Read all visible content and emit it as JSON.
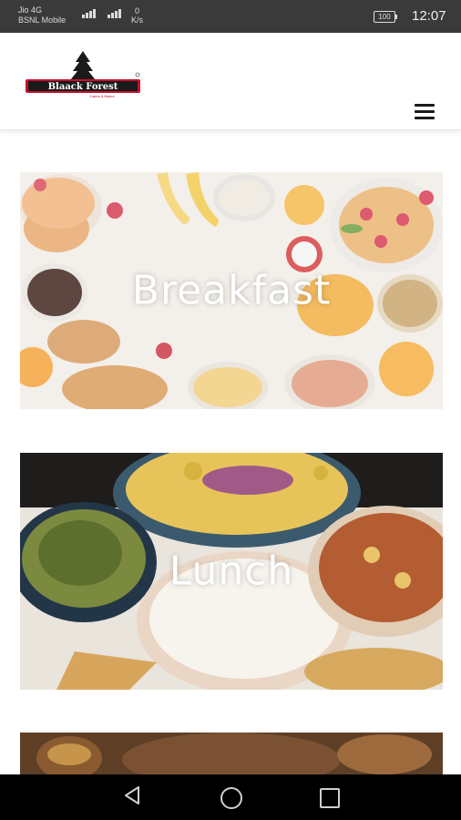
{
  "status_bar": {
    "carrier_line1": "Jio 4G",
    "carrier_line2": "BSNL Mobile",
    "net_speed_value": "0",
    "net_speed_unit": "K/s",
    "battery": "100",
    "time": "12:07"
  },
  "header": {
    "logo_text": "Blaack Forest",
    "logo_subtext": "Cakes & Bakes"
  },
  "cards": [
    {
      "label": "Breakfast"
    },
    {
      "label": "Lunch"
    }
  ],
  "colors": {
    "logo_red": "#c8102e",
    "logo_dark": "#1a1a1a",
    "status_bar_bg": "#3a3a3a",
    "nav_bar_bg": "#000000"
  }
}
